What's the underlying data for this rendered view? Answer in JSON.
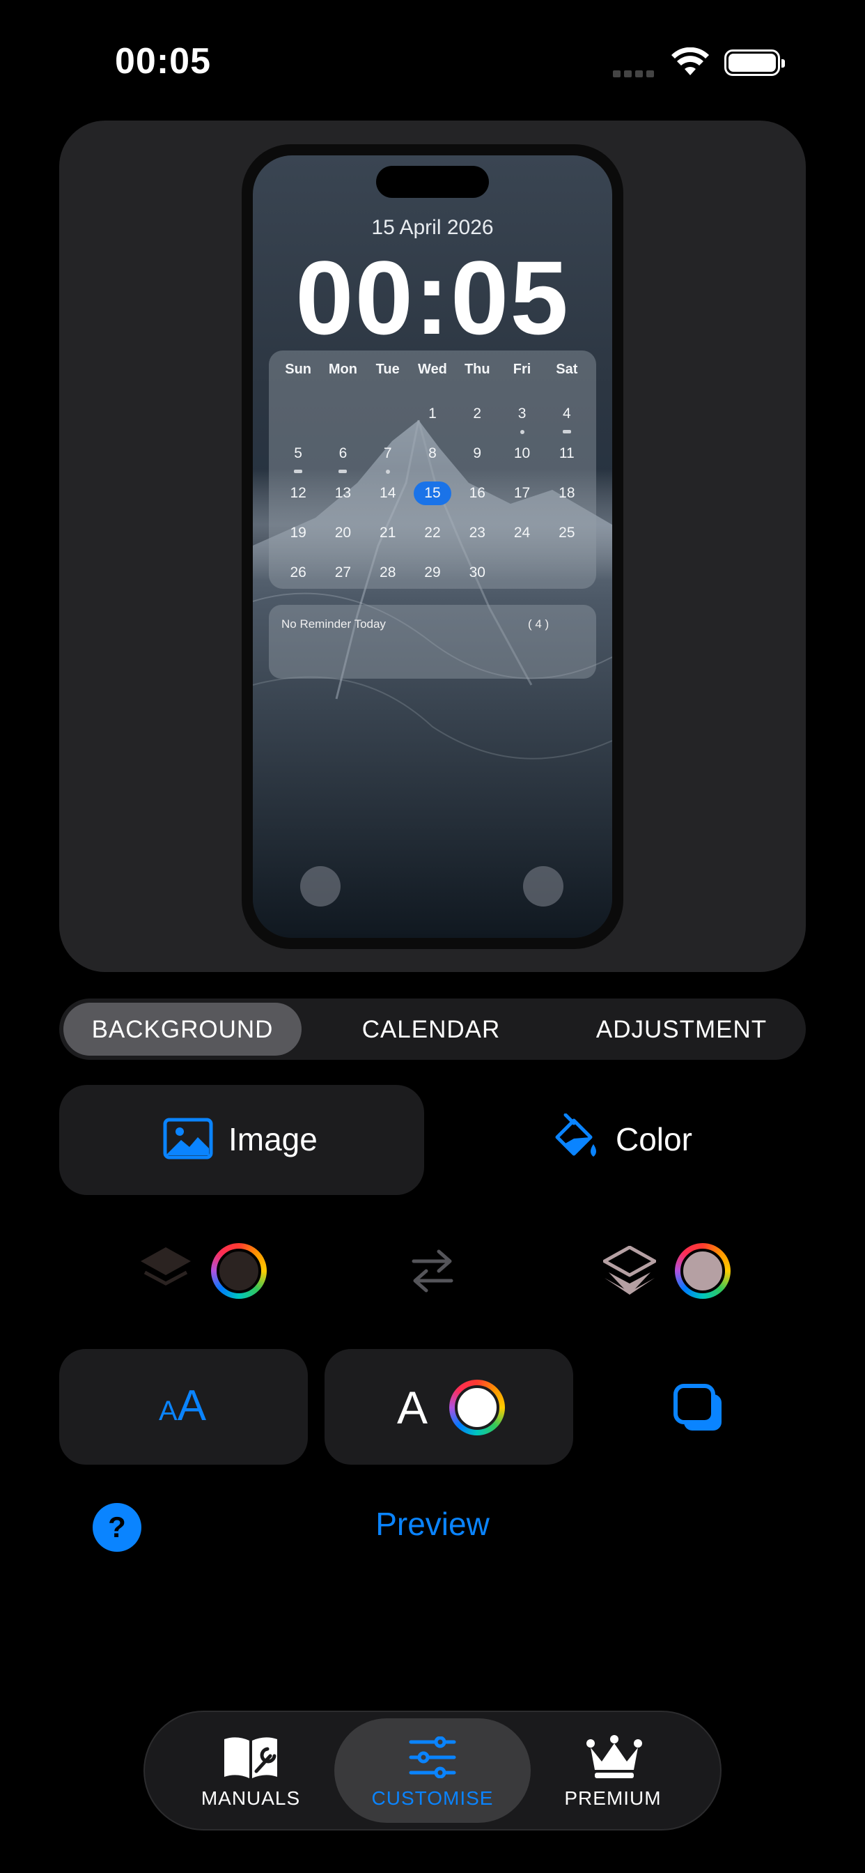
{
  "status_bar": {
    "time": "00:05"
  },
  "lock_screen": {
    "date": "15 April 2026",
    "time": "00:05",
    "calendar": {
      "weekdays": [
        "Sun",
        "Mon",
        "Tue",
        "Wed",
        "Thu",
        "Fri",
        "Sat"
      ],
      "weeks": [
        [
          "",
          "",
          "",
          "1",
          "2",
          "3",
          "4"
        ],
        [
          "5",
          "6",
          "7",
          "8",
          "9",
          "10",
          "11"
        ],
        [
          "12",
          "13",
          "14",
          "15",
          "16",
          "17",
          "18"
        ],
        [
          "19",
          "20",
          "21",
          "22",
          "23",
          "24",
          "25"
        ],
        [
          "26",
          "27",
          "28",
          "29",
          "30",
          "",
          ""
        ]
      ],
      "today": "15"
    },
    "reminder": {
      "text": "No Reminder Today",
      "count": "( 4 )"
    }
  },
  "segments": {
    "background": "BACKGROUND",
    "calendar": "CALENDAR",
    "adjustment": "ADJUSTMENT",
    "selected": "background"
  },
  "background_options": {
    "image_label": "Image",
    "color_label": "Color"
  },
  "colors": {
    "accent": "#0a84ff",
    "left_swatch": "#2b2321",
    "right_swatch": "#b5a0a3"
  },
  "font_button": {
    "glyph_small": "A",
    "glyph_large": "A"
  },
  "text_color_button": {
    "glyph": "A"
  },
  "preview_label": "Preview",
  "help_label": "?",
  "tabs": {
    "manuals": "MANUALS",
    "customise": "CUSTOMISE",
    "premium": "PREMIUM",
    "selected": "customise"
  }
}
